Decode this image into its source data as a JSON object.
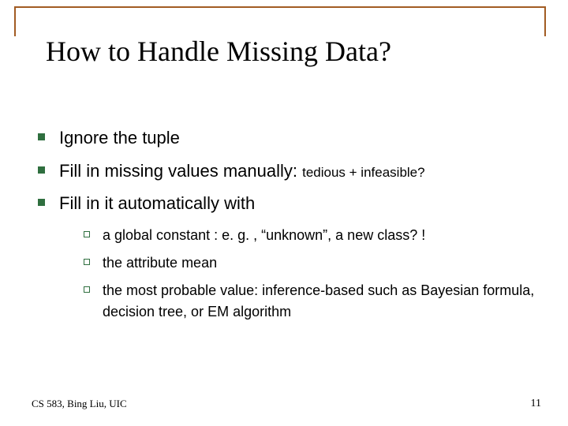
{
  "title": "How to Handle Missing Data?",
  "bullets": [
    {
      "text": "Ignore the tuple",
      "note": ""
    },
    {
      "text": "Fill in missing values manually: ",
      "note": "tedious + infeasible?"
    },
    {
      "text": "Fill in it automatically with",
      "note": ""
    }
  ],
  "subbullets": [
    "a global constant : e. g. , “unknown”, a new class? !",
    "the attribute mean",
    "the most probable value: inference-based such as Bayesian formula, decision tree, or EM algorithm"
  ],
  "footer": {
    "left": "CS 583, Bing Liu, UIC",
    "right": "11"
  }
}
